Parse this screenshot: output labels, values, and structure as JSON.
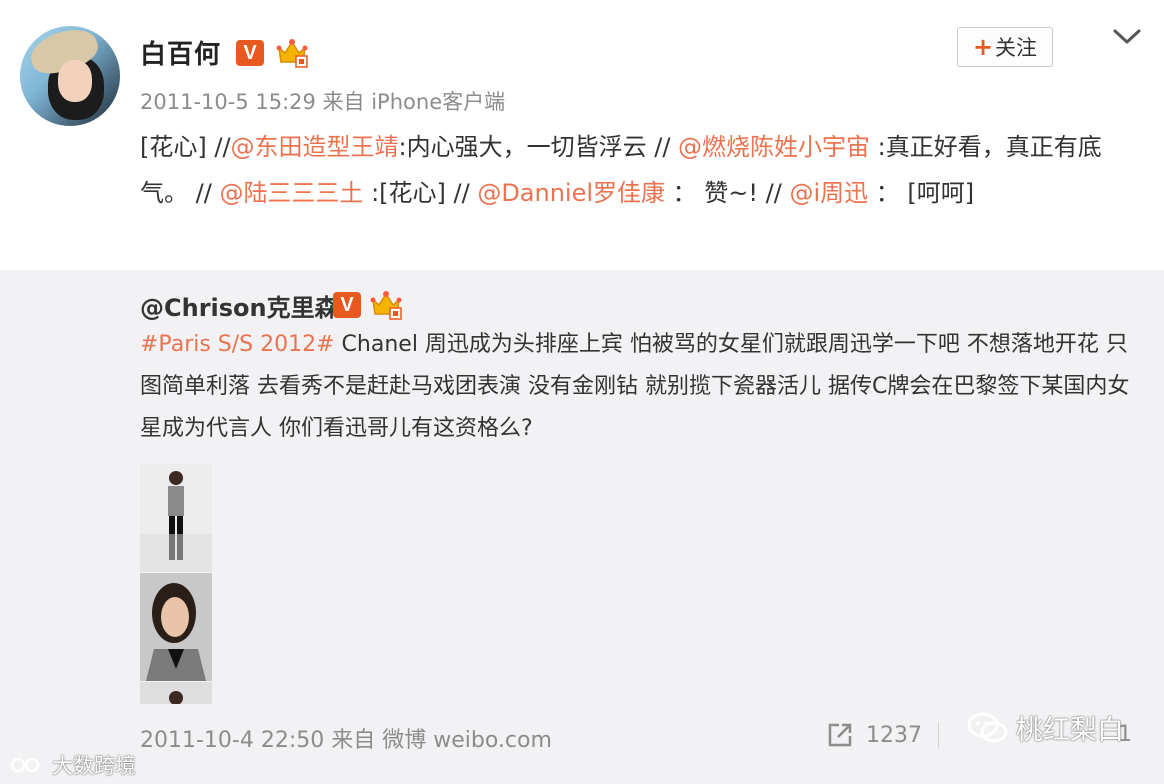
{
  "post": {
    "author": "白百何",
    "v_badge": "V",
    "follow_label": "关注",
    "follow_plus": "+",
    "meta": "2011-10-5 15:29 来自 iPhone客户端",
    "text_parts": [
      {
        "t": "[花心] //",
        "link": false
      },
      {
        "t": "@东田造型王靖",
        "link": true
      },
      {
        "t": ":内心强大，一切皆浮云 // ",
        "link": false
      },
      {
        "t": "@燃烧陈姓小宇宙",
        "link": true
      },
      {
        "t": " :真正好看，真正有底气。  // ",
        "link": false
      },
      {
        "t": "@陆三三三土",
        "link": true
      },
      {
        "t": " :[花心]  // ",
        "link": false
      },
      {
        "t": "@Danniel罗佳康",
        "link": true
      },
      {
        "t": " ： 赞~!   // ",
        "link": false
      },
      {
        "t": "@i周迅",
        "link": true
      },
      {
        "t": " ： [呵呵]",
        "link": false
      }
    ]
  },
  "repost": {
    "author": "@Chrison克里森",
    "v_badge": "V",
    "hashtag": "#Paris S/S 2012#",
    "body": " Chanel 周迅成为头排座上宾 怕被骂的女星们就跟周迅学一下吧 不想落地开花 只图简单利落 去看秀不是赶赴马戏团表演 没有金刚钻 就别揽下瓷器活儿 据传C牌会在巴黎签下某国内女星成为代言人 你们看迅哥儿有这资格么?",
    "meta": "2011-10-4 22:50 来自 微博 weibo.com",
    "share_count": "1237",
    "second_count": "1"
  },
  "watermarks": {
    "wechat": "桃红梨白",
    "bottom": "大数跨境"
  },
  "colors": {
    "link": "#eb7350",
    "badge": "#e8591f",
    "repost_bg": "#f2f2f5"
  },
  "icons": [
    "v-badge-icon",
    "crown-icon",
    "chevron-down-icon",
    "share-icon",
    "wechat-icon"
  ]
}
